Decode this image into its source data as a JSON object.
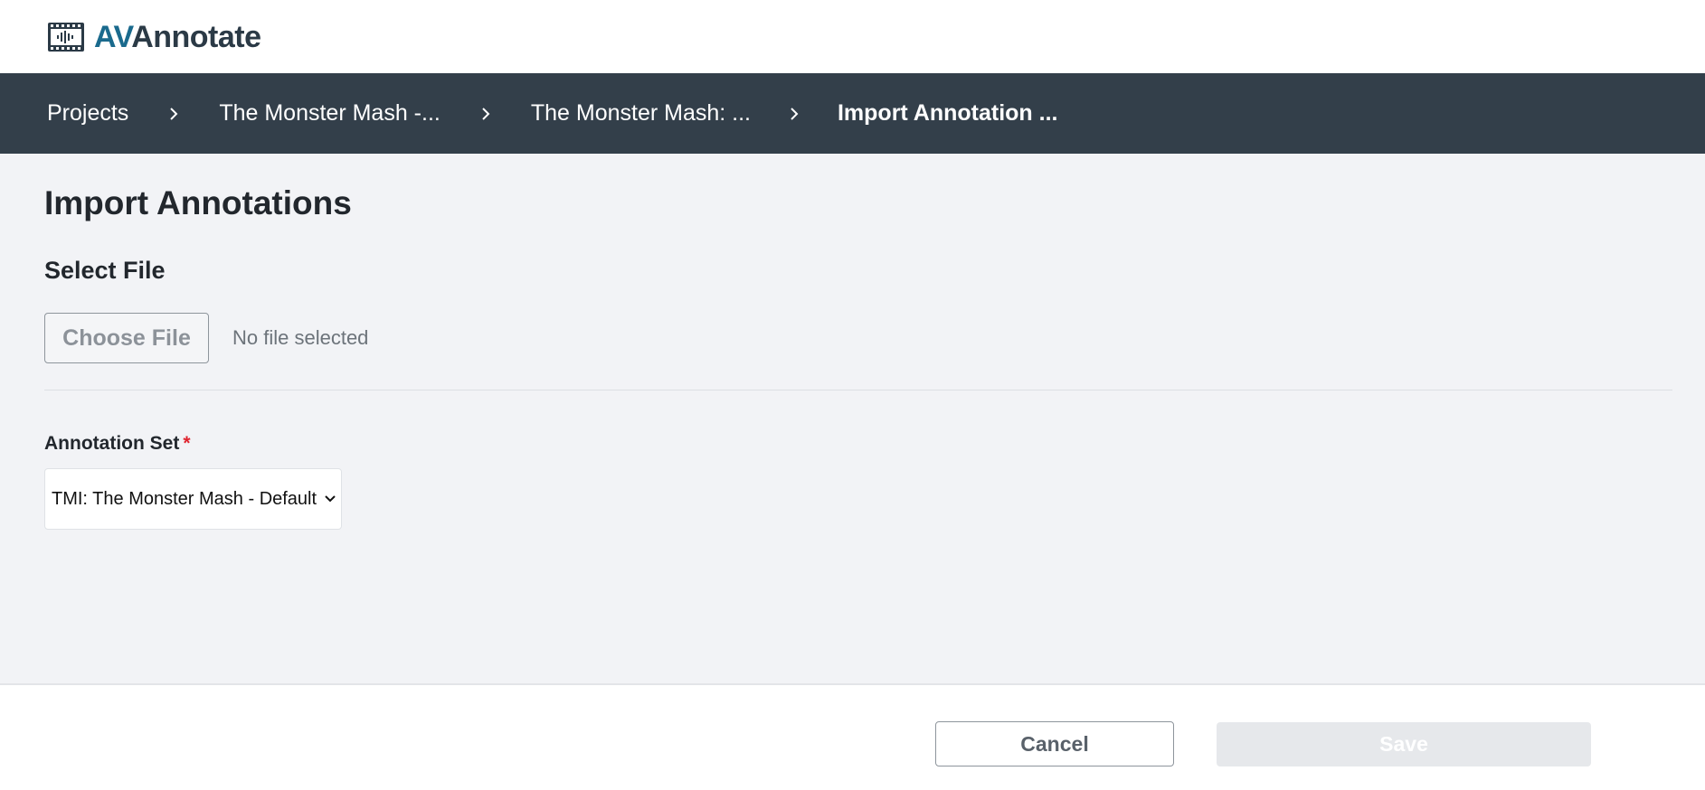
{
  "app": {
    "logo_prefix": "AV",
    "logo_suffix": "Annotate",
    "logo_icon": "film-waveform-icon",
    "colors": {
      "brand_blue": "#1a6a8d",
      "nav_bg": "#333f4a",
      "page_bg": "#f2f3f6",
      "required": "#e0232e"
    }
  },
  "breadcrumbs": [
    {
      "label": "Projects"
    },
    {
      "label": "The Monster Mash -..."
    },
    {
      "label": "The Monster Mash: ..."
    },
    {
      "label": "Import Annotation ..."
    }
  ],
  "page": {
    "title": "Import Annotations",
    "section_title": "Select File",
    "file": {
      "button_label": "Choose File",
      "status": "No file selected"
    },
    "annotation_set": {
      "label": "Annotation Set",
      "required_marker": "*",
      "selected_value": "TMI: The Monster Mash - Default"
    }
  },
  "footer": {
    "cancel_label": "Cancel",
    "save_label": "Save"
  }
}
